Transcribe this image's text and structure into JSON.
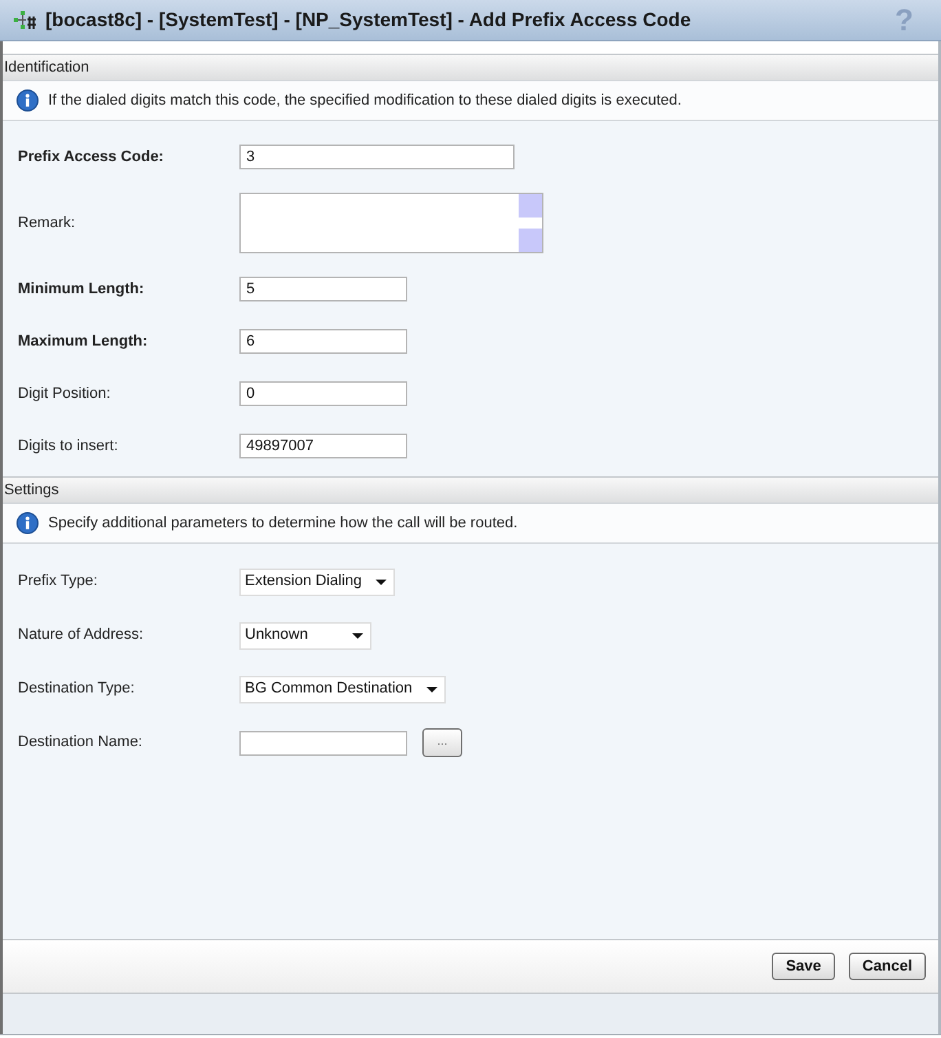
{
  "window": {
    "title": "[bocast8c] - [SystemTest] - [NP_SystemTest] - Add Prefix Access Code",
    "help": "?"
  },
  "sections": [
    {
      "title": "Identification",
      "info": "If the dialed digits match this code, the specified modification to these dialed digits is executed.",
      "fields": [
        {
          "kind": "text",
          "label": "Prefix Access Code:",
          "required": true,
          "value": "3"
        },
        {
          "kind": "textarea",
          "label": "Remark:",
          "required": false
        },
        {
          "kind": "text",
          "label": "Minimum Length:",
          "required": true,
          "value": "5"
        },
        {
          "kind": "text",
          "label": "Maximum Length:",
          "required": true,
          "value": "6"
        },
        {
          "kind": "text",
          "label": "Digit Position:",
          "required": false,
          "value": "0"
        },
        {
          "kind": "text",
          "label": "Digits to insert:",
          "required": false,
          "value": "49897007"
        }
      ]
    },
    {
      "title": "Settings",
      "info": "Specify additional parameters to determine how the call will be routed.",
      "fields": [
        {
          "kind": "select",
          "label": "Prefix Type:",
          "required": false,
          "value": "Extension Dialing"
        },
        {
          "kind": "select",
          "label": "Nature of Address:",
          "required": false,
          "value": "Unknown"
        },
        {
          "kind": "select",
          "label": "Destination Type:",
          "required": false,
          "value": "BG Common Destination"
        },
        {
          "kind": "browse",
          "label": "Destination Name:",
          "required": false,
          "button": "..."
        }
      ]
    }
  ],
  "buttons": [
    "Save",
    "Cancel"
  ]
}
